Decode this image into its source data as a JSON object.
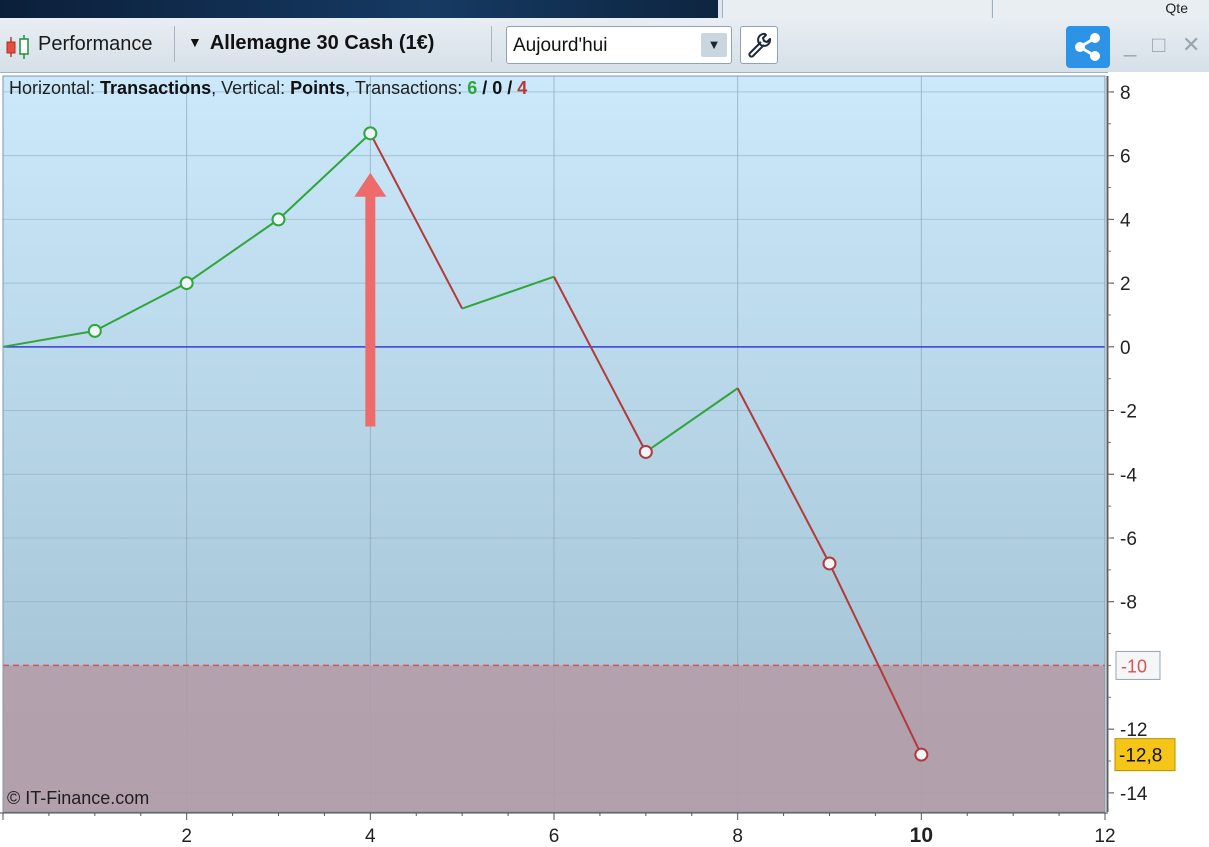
{
  "header": {
    "qte_label": "Qte",
    "chart_type_label": "Performance",
    "instrument_label": "Allemagne 30 Cash (1€)",
    "period_value": "Aujourd'hui"
  },
  "legend": {
    "horizontal_prefix": "Horizontal: ",
    "horizontal_value": "Transactions",
    "vertical_prefix": ", Vertical: ",
    "vertical_value": "Points",
    "transactions_prefix": ", Transactions: ",
    "wins": "6",
    "sep1": " / ",
    "draws": "0",
    "sep2": " / ",
    "losses": "4"
  },
  "copyright": "© IT-Finance.com",
  "chart_data": {
    "type": "line",
    "x": [
      0,
      1,
      2,
      3,
      4,
      5,
      6,
      7,
      8,
      9,
      10
    ],
    "y": [
      0,
      0.5,
      2,
      4,
      6.7,
      1.2,
      2.2,
      -3.3,
      -1.3,
      -6.8,
      -12.8
    ],
    "markers": [
      {
        "x": 1,
        "y": 0.5,
        "color": "#2fa63a"
      },
      {
        "x": 2,
        "y": 2,
        "color": "#2fa63a"
      },
      {
        "x": 3,
        "y": 4,
        "color": "#2fa63a"
      },
      {
        "x": 4,
        "y": 6.7,
        "color": "#2fa63a"
      },
      {
        "x": 7,
        "y": -3.3,
        "color": "#b33a3a"
      },
      {
        "x": 9,
        "y": -6.8,
        "color": "#b33a3a"
      },
      {
        "x": 10,
        "y": -12.8,
        "color": "#b33a3a"
      }
    ],
    "rising_color": "#2fa63a",
    "falling_color": "#b33a3a",
    "zero_line_color": "#3a3adf",
    "xlim": [
      0,
      12
    ],
    "ylim": [
      -14.6,
      8.5
    ],
    "x_ticks": [
      2,
      4,
      6,
      8,
      10,
      12
    ],
    "x_tick_labels": [
      "2",
      "4",
      "6",
      "8",
      "10",
      "12"
    ],
    "x_bold_tick": 10,
    "y_ticks": [
      8,
      6,
      4,
      2,
      0,
      -2,
      -4,
      -6,
      -8,
      -12,
      -14
    ],
    "y_tick_labels": [
      "8",
      "6",
      "4",
      "2",
      "0",
      "-2",
      "-4",
      "-6",
      "-8",
      "-12",
      "-14"
    ],
    "threshold": {
      "value": -10,
      "label": "-10",
      "color": "#d9534f"
    },
    "last_value": {
      "value": -12.8,
      "label": "-12,8",
      "color": "#f5c518"
    },
    "grid": true,
    "annotation_arrow": {
      "x": 4,
      "y_from": -2.5,
      "y_to": 5.4,
      "color": "#ee6b6b"
    }
  }
}
